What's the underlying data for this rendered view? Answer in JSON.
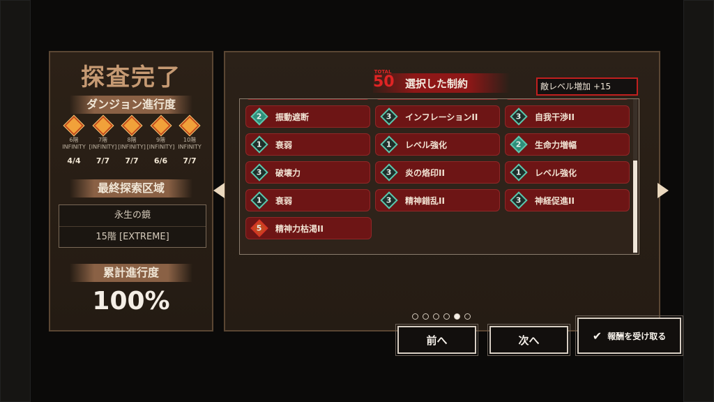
{
  "left": {
    "title": "探査完了",
    "dungeon_progress_label": "ダンジョン進行度",
    "floors": [
      {
        "name": "6階",
        "mode": "INFINITY",
        "count": "4/4"
      },
      {
        "name": "7階",
        "mode": "[INFINITY]",
        "count": "7/7"
      },
      {
        "name": "8階",
        "mode": "[INFINITY]",
        "count": "7/7"
      },
      {
        "name": "9階",
        "mode": "[INFINITY]",
        "count": "6/6"
      },
      {
        "name": "10階",
        "mode": "INFINITY",
        "count": "7/7"
      }
    ],
    "last_area_label": "最終探索区域",
    "last_area_name": "永生の鏡",
    "last_area_floor": "15階 [EXTREME]",
    "total_progress_label": "累計進行度",
    "total_progress_value": "100%"
  },
  "header": {
    "total_small": "TOTAL",
    "total_value": "50",
    "title": "選択した制約",
    "enemy_level": "敵レベル増加 +15"
  },
  "constraints": [
    [
      {
        "lvl": "2",
        "name": "振動遮断",
        "style": "hi"
      },
      {
        "lvl": "3",
        "name": "インフレーションII",
        "style": "normal"
      },
      {
        "lvl": "3",
        "name": "自我干渉II",
        "style": "normal"
      }
    ],
    [
      {
        "lvl": "1",
        "name": "衰弱",
        "style": "normal"
      },
      {
        "lvl": "1",
        "name": "レベル強化",
        "style": "normal"
      },
      {
        "lvl": "2",
        "name": "生命力増幅",
        "style": "hi"
      }
    ],
    [
      {
        "lvl": "3",
        "name": "破壊力",
        "style": "normal"
      },
      {
        "lvl": "3",
        "name": "炎の烙印II",
        "style": "normal"
      },
      {
        "lvl": "1",
        "name": "レベル強化",
        "style": "normal"
      }
    ],
    [
      {
        "lvl": "1",
        "name": "衰弱",
        "style": "normal"
      },
      {
        "lvl": "3",
        "name": "精神錯乱II",
        "style": "normal"
      },
      {
        "lvl": "3",
        "name": "神経促進II",
        "style": "normal"
      }
    ],
    [
      {
        "lvl": "5",
        "name": "精神力枯渇II",
        "style": "red"
      }
    ]
  ],
  "pagination": {
    "pages": 6,
    "current": 5
  },
  "buttons": {
    "prev": "前へ",
    "next": "次へ",
    "reward": "報酬を受け取る"
  },
  "colors": {
    "accent_red": "#8e1717",
    "teal": "#5cc7ad",
    "panel": "#2b2118"
  }
}
